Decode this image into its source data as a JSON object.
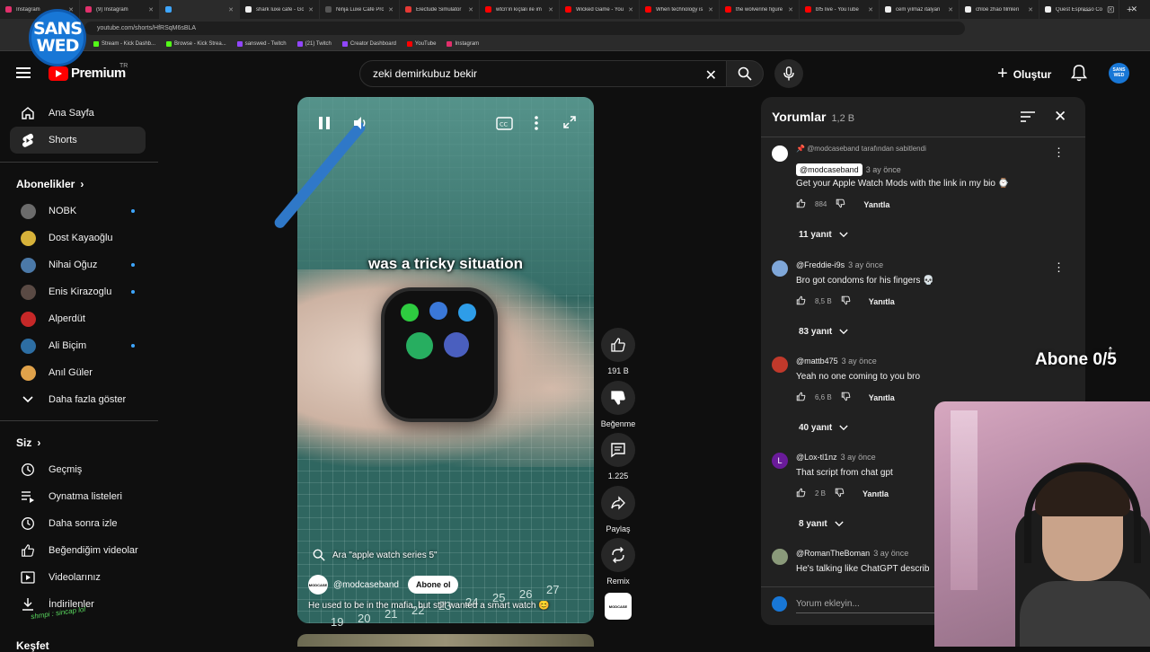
{
  "browser": {
    "tabs": [
      {
        "title": "Instagram",
        "color": "#e1306c"
      },
      {
        "title": "(9) Instagram",
        "color": "#e1306c"
      },
      {
        "title": "",
        "color": "#3ea6ff"
      },
      {
        "title": "shark luxe cafe - Go",
        "color": "#eeeeee"
      },
      {
        "title": "Ninja Luxe Café Pro",
        "color": "#555555"
      },
      {
        "title": "Electude Simulator",
        "color": "#e53935"
      },
      {
        "title": "wtcn'in kıçlalı ile im",
        "color": "#ff0000"
      },
      {
        "title": "Wicked Game - You",
        "color": "#ff0000"
      },
      {
        "title": "When technology is",
        "color": "#ff0000"
      },
      {
        "title": "the wolverine figure",
        "color": "#ff0000"
      },
      {
        "title": "bf5 live - YouTube",
        "color": "#ff0000"
      },
      {
        "title": "cem yılmaz italyan",
        "color": "#eeeeee"
      },
      {
        "title": "chloé zhao filmleri",
        "color": "#eeeeee"
      },
      {
        "title": "Quest Espresso Co",
        "color": "#eeeeee"
      }
    ],
    "url": "youtube.com/shorts/HfRSqM6sBLA",
    "bookmarks": [
      {
        "label": "Stream - Kick Dashb...",
        "color": "#53fc18"
      },
      {
        "label": "Browse - Kick Strea...",
        "color": "#53fc18"
      },
      {
        "label": "sanswed - Twitch",
        "color": "#9146ff"
      },
      {
        "label": "(21) Twitch",
        "color": "#9146ff"
      },
      {
        "label": "Creator Dashboard",
        "color": "#9146ff"
      },
      {
        "label": "YouTube",
        "color": "#ff0000"
      },
      {
        "label": "Instagram",
        "color": "#e1306c"
      }
    ]
  },
  "overlay": {
    "logo_line1": "SANS",
    "logo_line2": "WED",
    "abone_counter": "Abone 0/5",
    "signature": "shmpi : sincap lol"
  },
  "header": {
    "logo_word": "Premium",
    "logo_region": "TR",
    "search_value": "zeki demirkubuz bekir",
    "create_label": "Oluştur",
    "avatar_text": "SANS WED"
  },
  "sidebar": {
    "main": [
      {
        "label": "Ana Sayfa",
        "icon": "home-icon"
      },
      {
        "label": "Shorts",
        "icon": "shorts-icon"
      }
    ],
    "subs_heading": "Abonelikler",
    "subs": [
      {
        "label": "NOBK",
        "color": "#6b6b6b",
        "dot": true
      },
      {
        "label": "Dost Kayaoğlu",
        "color": "#d7b23a",
        "dot": false
      },
      {
        "label": "Nihai Oğuz",
        "color": "#4b79a8",
        "dot": true
      },
      {
        "label": "Enis Kirazoglu",
        "color": "#5a4a44",
        "dot": true
      },
      {
        "label": "Alperdüt",
        "color": "#c62828",
        "dot": false
      },
      {
        "label": "Ali Biçim",
        "color": "#2d6ea3",
        "dot": true
      },
      {
        "label": "Anıl Güler",
        "color": "#e0a24a",
        "dot": false
      }
    ],
    "show_more": "Daha fazla göster",
    "you_heading": "Siz",
    "you": [
      {
        "label": "Geçmiş",
        "icon": "history-icon"
      },
      {
        "label": "Oynatma listeleri",
        "icon": "playlist-icon"
      },
      {
        "label": "Daha sonra izle",
        "icon": "clock-icon"
      },
      {
        "label": "Beğendiğim videolar",
        "icon": "thumbs-up-icon"
      },
      {
        "label": "Videolarınız",
        "icon": "video-icon"
      },
      {
        "label": "İndirilenler",
        "icon": "download-icon"
      }
    ],
    "explore_heading": "Keşfet"
  },
  "video": {
    "caption": "was a tricky situation",
    "search_suggestion": "Ara \"apple watch series 5\"",
    "channel": "@modcaseband",
    "subscribe_label": "Abone ol",
    "description": "He used to be in the mafia, but still wanted a smart watch 😊",
    "avatar_text": "MODCASE",
    "ruler_numbers": [
      "19",
      "20",
      "21",
      "22",
      "23",
      "24",
      "25",
      "26",
      "27"
    ]
  },
  "actions": {
    "like_count": "191 B",
    "dislike_label": "Beğenme",
    "comment_count": "1.225",
    "share_label": "Paylaş",
    "remix_label": "Remix"
  },
  "comments": {
    "title": "Yorumlar",
    "count": "1,2 B",
    "items": [
      {
        "pinned_by": "@modcaseband tarafından sabitlendi",
        "author": "@modcaseband",
        "time": "3 ay önce",
        "text": "Get your Apple Watch Mods with the link in my bio ⌚",
        "likes": "884",
        "reply_label": "Yanıtla",
        "replies": "11 yanıt",
        "avatar_color": "#ffffff"
      },
      {
        "author": "@Freddie-i9s",
        "time": "3 ay önce",
        "text": "Bro got condoms for his fingers 💀",
        "likes": "8,5 B",
        "reply_label": "Yanıtla",
        "replies": "83 yanıt",
        "avatar_color": "#7fa7d9"
      },
      {
        "author": "@mattb475",
        "time": "3 ay önce",
        "text": "Yeah no one coming to you bro",
        "likes": "6,6 B",
        "reply_label": "Yanıtla",
        "replies": "40 yanıt",
        "avatar_color": "#c0392b"
      },
      {
        "author": "@Lox-tl1nz",
        "time": "3 ay önce",
        "text": "That script from chat gpt",
        "likes": "2 B",
        "reply_label": "Yanıtla",
        "replies": "8 yanıt",
        "avatar_color": "#6a1b9a",
        "avatar_letter": "L"
      },
      {
        "author": "@RomanTheBoman",
        "time": "3 ay önce",
        "text": "He's talking like ChatGPT describ",
        "avatar_color": "#8a9a7a"
      }
    ],
    "add_placeholder": "Yorum ekleyin..."
  }
}
